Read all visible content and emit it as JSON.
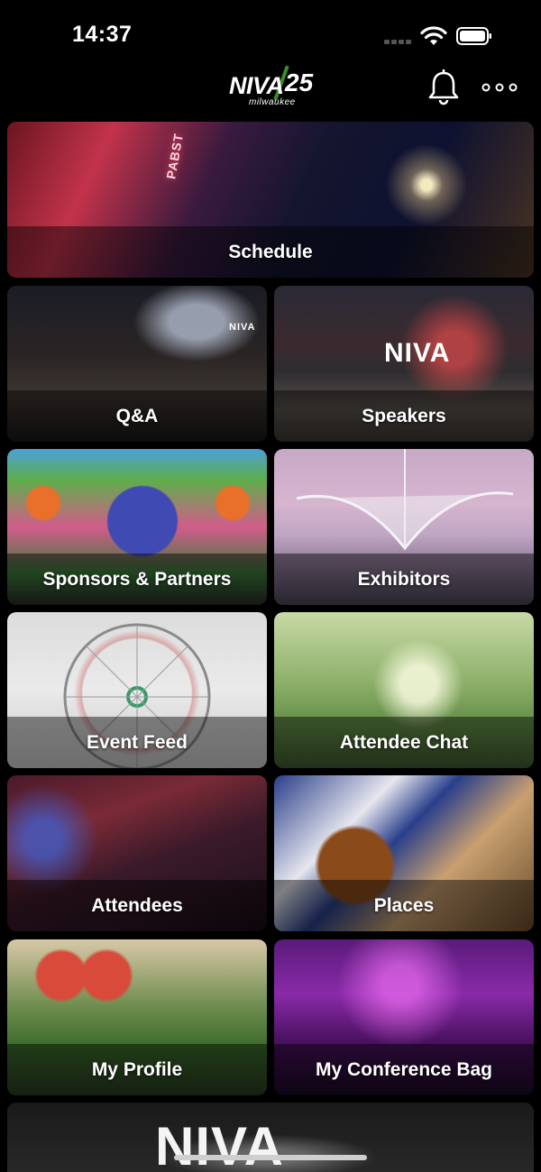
{
  "status_bar": {
    "time": "14:37"
  },
  "header": {
    "logo": {
      "wordmark": "NIVA",
      "year": "25",
      "city": "milwaukee"
    },
    "notifications_icon": "bell-icon",
    "more_icon": "more-horizontal-icon"
  },
  "tiles": [
    {
      "label": "Schedule"
    },
    {
      "label": "Q&A"
    },
    {
      "label": "Speakers"
    },
    {
      "label": "Sponsors & Partners"
    },
    {
      "label": "Exhibitors"
    },
    {
      "label": "Event Feed"
    },
    {
      "label": "Attendee Chat"
    },
    {
      "label": "Attendees"
    },
    {
      "label": "Places"
    },
    {
      "label": "My Profile"
    },
    {
      "label": "My Conference Bag"
    }
  ],
  "signage": {
    "pabst": "PABST",
    "qa_banner": "NIVA",
    "speakers_stage": "NIVA",
    "bottom_tile": "NIVA"
  }
}
